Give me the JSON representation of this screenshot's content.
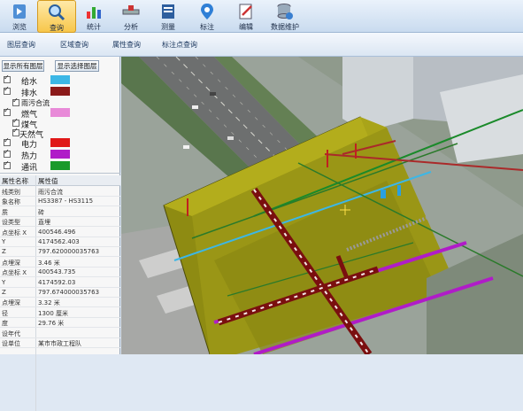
{
  "toolbar": {
    "items": [
      {
        "label": "浏览",
        "icon": "browse-icon"
      },
      {
        "label": "查询",
        "icon": "query-icon"
      },
      {
        "label": "统计",
        "icon": "statistics-icon"
      },
      {
        "label": "分析",
        "icon": "analysis-icon"
      },
      {
        "label": "测量",
        "icon": "measure-icon"
      },
      {
        "label": "标注",
        "icon": "marker-icon"
      },
      {
        "label": "编辑",
        "icon": "edit-icon"
      },
      {
        "label": "数据维护",
        "icon": "database-icon"
      }
    ],
    "active": "查询"
  },
  "subtabs": [
    "图层查询",
    "区域查询",
    "属性查询",
    "标注点查询"
  ],
  "layer_panel": {
    "show_all_button": "显示所有图层",
    "show_selected_button": "显示选择图层",
    "layers": [
      {
        "name": "给水",
        "color": "#3cb7e6",
        "checked": true
      },
      {
        "name": "排水",
        "color": "#8b1a1a",
        "checked": true
      },
      {
        "name": "雨污合流",
        "color": "",
        "checked": true
      },
      {
        "name": "燃气",
        "color": "#e88ad8",
        "checked": true
      },
      {
        "name": "煤气",
        "color": "",
        "checked": true
      },
      {
        "name": "天然气",
        "color": "",
        "checked": true
      },
      {
        "name": "电力",
        "color": "#e01818",
        "checked": true
      },
      {
        "name": "热力",
        "color": "#b01cc8",
        "checked": true
      },
      {
        "name": "通讯",
        "color": "#1a9a2a",
        "checked": true
      }
    ]
  },
  "properties": {
    "header_name": "属性名称",
    "header_value": "属性值",
    "rows": [
      {
        "k": "线类别",
        "v": "雨污合流"
      },
      {
        "k": "象名称",
        "v": "HS3387 - HS3115"
      },
      {
        "k": "质",
        "v": "砖"
      },
      {
        "k": "设类型",
        "v": "直埋"
      },
      {
        "k": "点坐标 X",
        "v": "400546.496"
      },
      {
        "k": "Y",
        "v": "4174562.403"
      },
      {
        "k": "Z",
        "v": "797.620000035763"
      },
      {
        "k": "点埋深",
        "v": "3.46 米"
      },
      {
        "k": "点坐标 X",
        "v": "400543.735"
      },
      {
        "k": "Y",
        "v": "4174592.03"
      },
      {
        "k": "Z",
        "v": "797.674000035763"
      },
      {
        "k": "点埋深",
        "v": "3.32 米"
      },
      {
        "k": "径",
        "v": "1300  厘米"
      },
      {
        "k": "度",
        "v": "29.76 米"
      },
      {
        "k": "设年代",
        "v": ""
      },
      {
        "k": "设单位",
        "v": "某市市政工程队"
      }
    ]
  }
}
